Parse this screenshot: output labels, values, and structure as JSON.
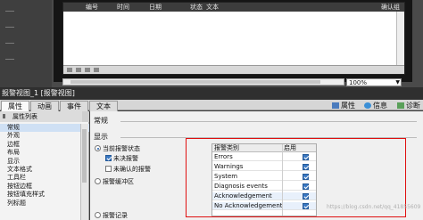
{
  "alarm_view": {
    "columns": [
      "编号",
      "时间",
      "日期",
      "状态",
      "文本",
      "确认组"
    ],
    "zoom": "100%"
  },
  "properties": {
    "title": "报警视图_1 [报警视图]",
    "tabs": [
      {
        "label": "属性",
        "active": true
      },
      {
        "label": "动画",
        "active": false
      },
      {
        "label": "事件",
        "active": false
      },
      {
        "label": "文本",
        "active": false
      }
    ],
    "right_tabs": [
      "属性",
      "信息",
      "诊断"
    ],
    "list_header": "属性列表",
    "list_items": [
      "常规",
      "外观",
      "边框",
      "布局",
      "显示",
      "文本格式",
      "工具栏",
      "按钮边框",
      "按钮填充样式",
      "列标题"
    ],
    "selected_item": "常规",
    "section_general": "常规",
    "section_display": "显示",
    "options": {
      "current_state": "当前报警状态",
      "unresolved": "未决报警",
      "unacknowledged": "未确认的报警",
      "buffer": "报警缓冲区",
      "log": "报警记录"
    },
    "state_table": {
      "headers": [
        "报警类别",
        "启用"
      ],
      "rows": [
        {
          "name": "Errors",
          "enabled": true
        },
        {
          "name": "Warnings",
          "enabled": true
        },
        {
          "name": "System",
          "enabled": true
        },
        {
          "name": "Diagnosis events",
          "enabled": true
        },
        {
          "name": "Acknowledgement",
          "enabled": true
        },
        {
          "name": "No Acknowledgement",
          "enabled": true
        }
      ]
    },
    "watermark": "https://blog.csdn.net/qq_41855609"
  }
}
